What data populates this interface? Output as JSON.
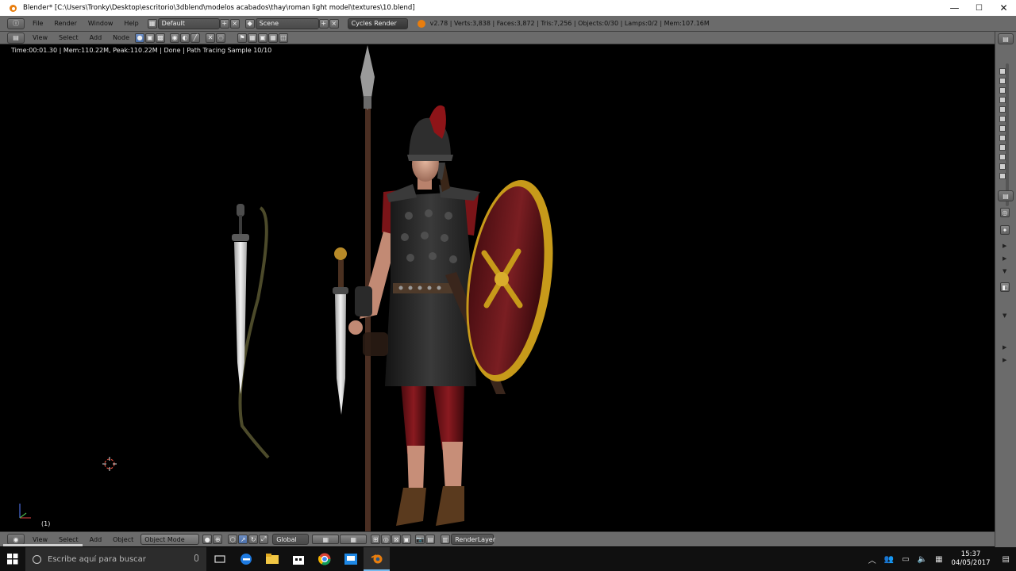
{
  "window": {
    "title": "Blender* [C:\\Users\\Tronky\\Desktop\\escritorio\\3dblend\\modelos acabados\\thay\\roman light model\\textures\\10.blend]",
    "minimize": "—",
    "maximize": "☐",
    "close": "✕"
  },
  "infobar": {
    "menus": [
      "File",
      "Render",
      "Window",
      "Help"
    ],
    "layout": "Default",
    "scene": "Scene",
    "engine": "Cycles Render",
    "stats": "v2.78 | Verts:3,838 | Faces:3,872 | Tris:7,256 | Objects:0/30 | Lamps:0/2 | Mem:107.16M"
  },
  "view_header": {
    "menus": [
      "View",
      "Select",
      "Add",
      "Node"
    ]
  },
  "viewport": {
    "render_status": "Time:00:01.30 | Mem:110.22M, Peak:110.22M | Done | Path Tracing Sample 10/10",
    "frame": "(1)"
  },
  "bottom_header": {
    "menus": [
      "View",
      "Select",
      "Add",
      "Object"
    ],
    "mode": "Object Mode",
    "orientation": "Global",
    "render_layer": "RenderLayer"
  },
  "taskbar": {
    "search_placeholder": "Escribe aquí para buscar",
    "time": "15:37",
    "date": "04/05/2017"
  },
  "colors": {
    "blender_orange": "#e87d0d",
    "blender_header": "#6b6b6b",
    "taskbar": "#101010",
    "tunic_red": "#7a1418",
    "shield_red": "#6e1a1e",
    "shield_gold": "#c79a1a"
  }
}
